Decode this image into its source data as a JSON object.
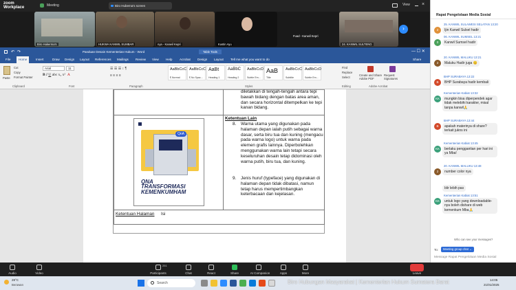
{
  "zoom": {
    "brand_line1": "zoom",
    "brand_line2": "Workplace",
    "meeting_label": "Meeting",
    "share_label": "Biro Hubema's screen",
    "view_label": "View",
    "participants": [
      {
        "name": "Biro Hukerma's"
      },
      {
        "name": "HUKWA KANWIL SUMBAR"
      },
      {
        "name": "nya - Kanwil Kepri"
      },
      {
        "name": "Kustin Ayu"
      },
      {
        "name": "Fuad - Kanwil Kepri"
      },
      {
        "name": "24. KANWIL SULTENG"
      }
    ],
    "toolbar": [
      {
        "label": "Audio"
      },
      {
        "label": "Video"
      },
      {
        "label": "Participants",
        "count": "251"
      },
      {
        "label": "Chat"
      },
      {
        "label": "React"
      },
      {
        "label": "Share"
      },
      {
        "label": "AI Companion"
      },
      {
        "label": "Apps"
      },
      {
        "label": "More"
      },
      {
        "label": "Leave"
      }
    ]
  },
  "word": {
    "title": "Panduan Desain Kementerian Hukum  -  Word",
    "table_tools": "Table Tools",
    "tell_me": "Tell me what you want to do",
    "share": "Share",
    "tabs": [
      "File",
      "Home",
      "Insert",
      "Draw",
      "Design",
      "Layout",
      "References",
      "Mailings",
      "Review",
      "View",
      "Help",
      "Acrobat",
      "Design",
      "Layout"
    ],
    "font_name": "Arial",
    "font_size": "11",
    "clipboard": {
      "paste": "Paste",
      "cut": "Cut",
      "copy": "Copy",
      "format_painter": "Format Painter"
    },
    "groups": [
      "Clipboard",
      "Font",
      "Paragraph",
      "Styles",
      "Editing",
      "Adobe Acrobat"
    ],
    "styles": [
      {
        "sample": "AaBbCcC",
        "label": "¶ Normal"
      },
      {
        "sample": "AaBbCcC",
        "label": "¶ No Spac..."
      },
      {
        "sample": "AaBt",
        "label": "Heading 1"
      },
      {
        "sample": "AaBbC",
        "label": "Heading 2"
      },
      {
        "sample": "AaBbCcD",
        "label": "Subtle Em..."
      },
      {
        "sample": "AaB",
        "label": "Title"
      },
      {
        "sample": "AaBbCcC",
        "label": "Subtitle"
      },
      {
        "sample": "AaBbCcD",
        "label": "Subtle Em..."
      }
    ],
    "editing": [
      "Find",
      "Replace",
      "Select"
    ],
    "acrobat": [
      "Create and Share Adobe PDF",
      "Request Signatures"
    ],
    "doc": {
      "top_text": "diletakkan di tengah-tengah antara tepi bawah bidang dengan batas area aman, dan secara horizontal ditempelkan ke tepi kanan bidang.",
      "heading": "Ketentuan Lain",
      "item8_num": "8.",
      "item8": "Warna utama yang digunakan pada halaman depan ialah putih sebagai warna dasar, serta biru tua dan kuning (mengacu pada warna logo) untuk warna pada elemen grafis lainnya. Diperbolehkan menggunakan warna lain tetapi secara keseluruhan desain tetap didominasi oleh warna putih, biru tua, dan kuning.",
      "item9_num": "9.",
      "item9": "Jenis huruf (typeface) yang digunakan di halaman depan tidak dibatasi, namun tetap harus mempertimbangkan keterbacaan dan kejelasan.",
      "bottom_label": "Ketentuan Halaman",
      "bottom_value": "Isi",
      "image_text1": "QNA",
      "image_text2": "TRANSFORMASI",
      "image_text3": "KEMENKUMHAM",
      "bubble": "QnA"
    }
  },
  "chat": {
    "title": "Rapat Pengelolaan Media Sosial",
    "messages": [
      {
        "name": "25. KANWIL SULAWESI SELATAN 13:20",
        "text": "Ijin Kanwil Sulsel hadir",
        "initial": "2",
        "color": "#e0913a"
      },
      {
        "name": "06. KANWIL SUMSEL 13:21",
        "text": "Kanwil Sumsel hadir",
        "initial": "0",
        "color": "#4aa05a"
      },
      {
        "name": "20. KANWIL MALUKU 13:21",
        "text": "Maluku Hadir juga 😊",
        "initial": "2",
        "color": "#8a5a2a"
      },
      {
        "name": "BHP SURABAYA 13:22",
        "text": "BHP Surabaya hadir kembali",
        "initial": "B",
        "color": "#d34a2a"
      },
      {
        "name": "Kementerian Kabiat 13:32",
        "text": "mungkin bisa diperpendek agar tidak melebihi karakter, misal tanpa kanwil🙏",
        "initial": "KK",
        "color": "#3aa07a"
      },
      {
        "name": "BHP SURABAYA 13:44",
        "text": "apakah materinya di share? terkait jukns ini",
        "initial": "B",
        "color": "#d34a2a"
      },
      {
        "name": "Kementerian Kabiat 13:45",
        "text": "berlaku penggantian per hari ini ya Mba!",
        "initial": "KK",
        "color": "#3aa07a"
      },
      {
        "name": "20. KANWIL MALUKU 13:48",
        "text": "number color nya",
        "initial": "2",
        "color": "#8a5a2a"
      },
      {
        "name": "",
        "text": "blir lebih pas",
        "initial": "",
        "color": ""
      },
      {
        "name": "Kementerian Kabiat 13:51",
        "text": "untuk logo yang downloadable-nya boleh dishare di web kemenkum Mba🙏",
        "initial": "KK",
        "color": "#3aa07a"
      }
    ],
    "who_can_see": "Who can see your messages?",
    "to_label": "To:",
    "to_value": "Meeting group chat ⌄",
    "placeholder": "Message Rapat Pengelolaan Media Sosial"
  },
  "taskbar": {
    "weather_temp": "28°C",
    "weather_desc": "Berawan",
    "search_placeholder": "Search",
    "watermark": "Biro Hubungan Masyarakat | Kementerian Hukum Sumatera Barat",
    "time": "14:05",
    "date": "21/01/2025"
  }
}
